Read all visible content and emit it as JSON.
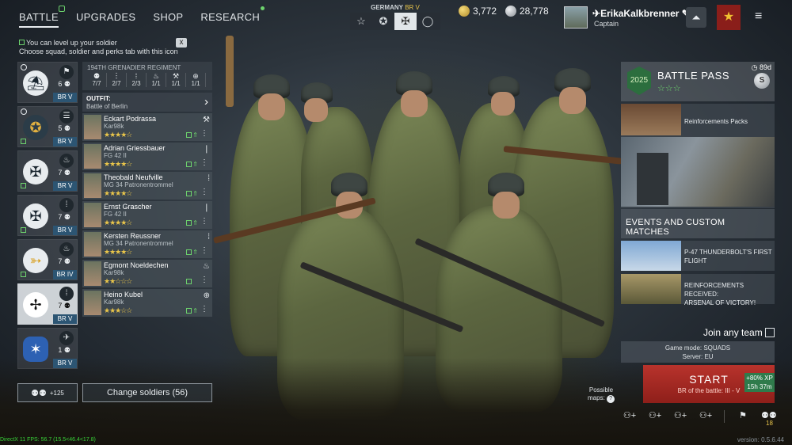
{
  "nav": {
    "tabs": [
      {
        "label": "BATTLE",
        "active": true
      },
      {
        "label": "UPGRADES"
      },
      {
        "label": "SHOP"
      },
      {
        "label": "RESEARCH"
      }
    ]
  },
  "hint": {
    "line1": "You can level up your soldier",
    "line2": "Choose squad, soldier and perks tab with this icon",
    "close": "x"
  },
  "nation": {
    "name": "GERMANY",
    "br": "BR V",
    "icons": [
      "star-outline",
      "star-circle",
      "balkenkreuz",
      "circle"
    ]
  },
  "currency": {
    "gold": "3,772",
    "silver": "28,778"
  },
  "profile": {
    "username": "ErikaKalkbrenner",
    "rank": "Captain"
  },
  "squads": [
    {
      "icon": "parachute",
      "count": "6",
      "br": "BR V",
      "type": "paratrooper",
      "active": false
    },
    {
      "icon": "pilot-wings",
      "count": "5",
      "br": "BR V",
      "type": "assault",
      "active": false
    },
    {
      "icon": "balkenkreuz",
      "count": "7",
      "br": "BR V",
      "type": "flamethrower",
      "active": false
    },
    {
      "icon": "balkenkreuz",
      "count": "7",
      "br": "BR V",
      "type": "machinegun",
      "active": false
    },
    {
      "icon": "bow",
      "count": "7",
      "br": "BR IV",
      "type": "flamethrower",
      "active": false
    },
    {
      "icon": "eagle-cross",
      "count": "7",
      "br": "BR V",
      "type": "infantry",
      "active": true
    },
    {
      "icon": "blue-eagle",
      "count": "1",
      "br": "BR V",
      "type": "fighter-plane",
      "active": false
    }
  ],
  "regiment": {
    "title": "194TH GRENADIER REGIMENT",
    "stats": [
      "7/7",
      "2/7",
      "2/3",
      "1/1",
      "1/1",
      "1/1"
    ]
  },
  "outfit": {
    "label": "OUTFIT:",
    "value": "Battle of Berlin"
  },
  "soldiers": [
    {
      "name": "Eckart Podrassa",
      "weapon": "Kar98k",
      "stars": "★★★★☆",
      "icon": "wrench"
    },
    {
      "name": "Adrian Griessbauer",
      "weapon": "FG 42 II",
      "stars": "★★★★☆",
      "icon": "bullet"
    },
    {
      "name": "Theobald Neufville",
      "weapon": "MG 34 Patronentrommel",
      "stars": "★★★★☆",
      "icon": "ammo"
    },
    {
      "name": "Ernst Grascher",
      "weapon": "FG 42 II",
      "stars": "★★★★☆",
      "icon": "bullet"
    },
    {
      "name": "Kersten Reussner",
      "weapon": "MG 34 Patronentrommel",
      "stars": "★★★★☆",
      "icon": "ammo"
    },
    {
      "name": "Egmont Noeldechen",
      "weapon": "Kar98k",
      "stars": "★★☆☆☆",
      "icon": "flame"
    },
    {
      "name": "Heino Kubel",
      "weapon": "Kar98k",
      "stars": "★★★☆☆",
      "icon": "plus"
    }
  ],
  "bottom_left": {
    "recruit_count": "+125",
    "change_soldiers": "Change soldiers (56)"
  },
  "battle_pass": {
    "title": "BATTLE PASS",
    "stars": "☆☆☆",
    "days": "89d",
    "badge": "2025",
    "coin": "S"
  },
  "reinforcements": {
    "label": "Reinforcements Packs"
  },
  "events": {
    "header": "EVENTS AND CUSTOM MATCHES",
    "items": [
      {
        "line1": "P-47 THUNDERBOLT'S FIRST",
        "line2": "FLIGHT"
      },
      {
        "line1": "REINFORCEMENTS RECEIVED:",
        "line2": "ARSENAL OF VICTORY!"
      }
    ]
  },
  "matchmaking": {
    "join_any_team": "Join any team",
    "game_mode": "Game mode: SQUADS",
    "server": "Server: EU",
    "possible_maps_1": "Possible",
    "possible_maps_2": "maps:",
    "start_label": "START",
    "start_sub": "BR of the battle: III - V",
    "xp_line1": "+80% XP",
    "xp_line2": "15h 37m"
  },
  "team": {
    "count": "18"
  },
  "debug": {
    "fps": "DirectX 11 FPS: 56.7 (15.5<46.4<17.8)",
    "version": "version: 0.5.6.44"
  },
  "colors": {
    "accent_green": "#6dd36d",
    "gold_star": "#e9c54a",
    "start_red": "#b8332c",
    "br_blue": "#2c5573"
  }
}
